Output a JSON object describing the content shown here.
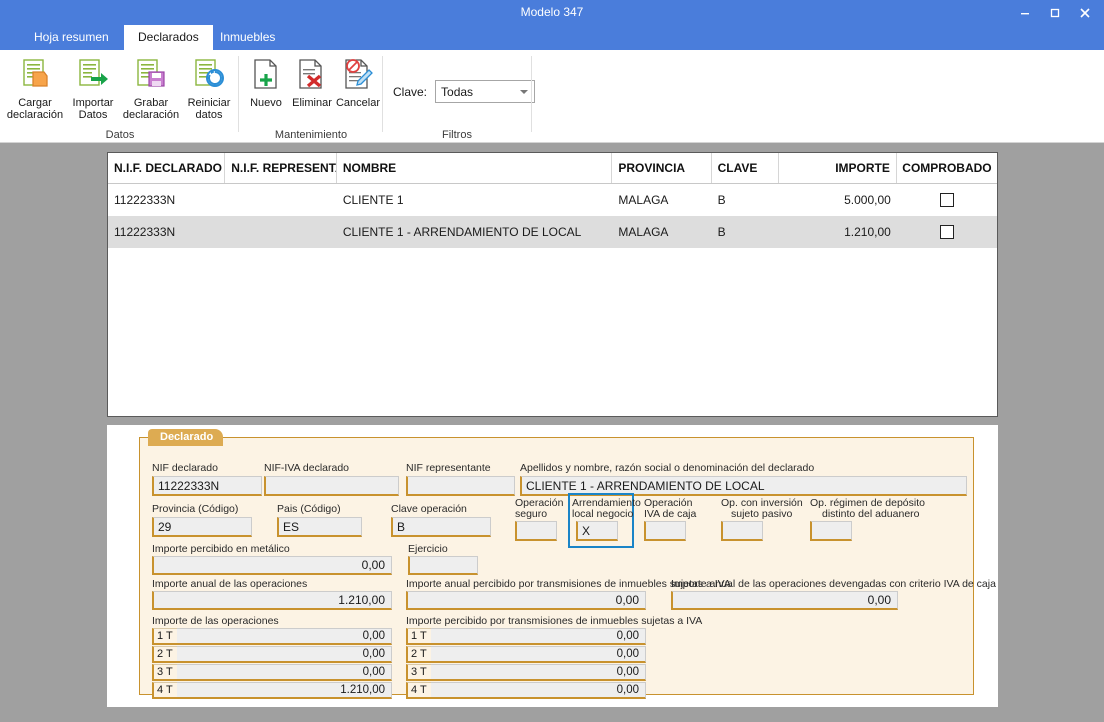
{
  "window": {
    "title": "Modelo 347",
    "minimize_icon": "minimize-icon",
    "maximize_icon": "maximize-icon",
    "close_icon": "close-icon"
  },
  "tabs": [
    {
      "label": "Hoja resumen",
      "active": false
    },
    {
      "label": "Declarados",
      "active": true
    },
    {
      "label": "Inmuebles",
      "active": false
    }
  ],
  "ribbon": {
    "groups": [
      {
        "label": "Datos"
      },
      {
        "label": "Mantenimiento"
      },
      {
        "label": "Filtros"
      }
    ],
    "datos_buttons": [
      {
        "line1": "Cargar",
        "line2": "declaración",
        "icon": "load-document-icon"
      },
      {
        "line1": "Importar",
        "line2": "Datos",
        "icon": "import-arrow-icon"
      },
      {
        "line1": "Grabar",
        "line2": "declaración",
        "icon": "save-floppy-icon"
      },
      {
        "line1": "Reiniciar",
        "line2": "datos",
        "icon": "refresh-icon"
      }
    ],
    "mantenimiento_buttons": [
      {
        "line1": "Nuevo",
        "line2": "",
        "icon": "new-document-icon"
      },
      {
        "line1": "Eliminar",
        "line2": "",
        "icon": "delete-document-icon"
      },
      {
        "line1": "Cancelar",
        "line2": "",
        "icon": "cancel-edit-icon"
      }
    ],
    "filter": {
      "label": "Clave:",
      "value": "Todas",
      "dropdown_icon": "chevron-down-icon"
    }
  },
  "grid": {
    "columns": [
      {
        "key": "nif",
        "label": "N.I.F. DECLARADO"
      },
      {
        "key": "rep",
        "label": "N.I.F. REPRESENTA..."
      },
      {
        "key": "nombre",
        "label": "NOMBRE"
      },
      {
        "key": "provincia",
        "label": "PROVINCIA"
      },
      {
        "key": "clave",
        "label": "CLAVE"
      },
      {
        "key": "importe",
        "label": "IMPORTE"
      },
      {
        "key": "comprobado",
        "label": "COMPROBADO"
      }
    ],
    "rows": [
      {
        "nif": "11222333N",
        "rep": "",
        "nombre": "CLIENTE 1",
        "provincia": "MALAGA",
        "clave": "B",
        "importe": "5.000,00",
        "comprobado": false,
        "selected": false
      },
      {
        "nif": "11222333N",
        "rep": "",
        "nombre": "CLIENTE 1 - ARRENDAMIENTO DE LOCAL",
        "provincia": "MALAGA",
        "clave": "B",
        "importe": "1.210,00",
        "comprobado": false,
        "selected": true
      }
    ]
  },
  "detail": {
    "group_title": "Declarado",
    "fields": {
      "nif_declarado": {
        "label": "NIF declarado",
        "value": "11222333N"
      },
      "nif_iva_declarado": {
        "label": "NIF-IVA declarado",
        "value": ""
      },
      "nif_representante": {
        "label": "NIF representante",
        "value": ""
      },
      "nombre_declarado": {
        "label": "Apellidos y nombre, razón social o denominación del declarado",
        "value": "CLIENTE 1 - ARRENDAMIENTO DE LOCAL"
      },
      "provincia": {
        "label": "Provincia (Código)",
        "value": "29"
      },
      "pais": {
        "label": "Pais (Código)",
        "value": "ES"
      },
      "clave_operacion": {
        "label": "Clave operación",
        "value": "B"
      },
      "operacion_seguro": {
        "label": "Operación\nseguro",
        "label1": "Operación",
        "label2": "seguro",
        "value": ""
      },
      "arrendamiento_local": {
        "label1": "Arrendamiento",
        "label2": "local negocio",
        "value": "X",
        "focused": true
      },
      "operacion_iva_caja": {
        "label1": "Operación",
        "label2": "IVA de caja",
        "value": ""
      },
      "op_inversion_sujeto_pasivo": {
        "label1": "Op. con inversión",
        "label2": "sujeto pasivo",
        "value": ""
      },
      "op_regimen_deposito": {
        "label1": "Op. régimen de depósito",
        "label2": "distinto del aduanero",
        "value": ""
      },
      "importe_metalico": {
        "label": "Importe percibido en metálico",
        "value": "0,00"
      },
      "ejercicio": {
        "label": "Ejercicio",
        "value": ""
      },
      "importe_anual_operaciones": {
        "label": "Importe anual de las operaciones",
        "value": "1.210,00"
      },
      "importe_anual_transmisiones": {
        "label": "Importe anual percibido por transmisiones de inmuebles sujetas a IVA",
        "value": "0,00"
      },
      "importe_anual_iva_caja": {
        "label": "Importe anual de las operaciones devengadas con criterio IVA de caja",
        "value": "0,00"
      }
    },
    "quarterly_left": {
      "label": "Importe de las operaciones",
      "rows": [
        {
          "period": "1 T",
          "value": "0,00"
        },
        {
          "period": "2 T",
          "value": "0,00"
        },
        {
          "period": "3 T",
          "value": "0,00"
        },
        {
          "period": "4 T",
          "value": "1.210,00"
        }
      ]
    },
    "quarterly_right": {
      "label": "Importe percibido por transmisiones de inmuebles sujetas a IVA",
      "rows": [
        {
          "period": "1 T",
          "value": "0,00"
        },
        {
          "period": "2 T",
          "value": "0,00"
        },
        {
          "period": "3 T",
          "value": "0,00"
        },
        {
          "period": "4 T",
          "value": "0,00"
        }
      ]
    }
  },
  "colors": {
    "titlebar": "#4a7ddb",
    "accent_orange": "#c8922e",
    "form_bg": "#fcf3e4",
    "focus_blue": "#1a84c7",
    "backdrop": "#a0a0a0"
  }
}
